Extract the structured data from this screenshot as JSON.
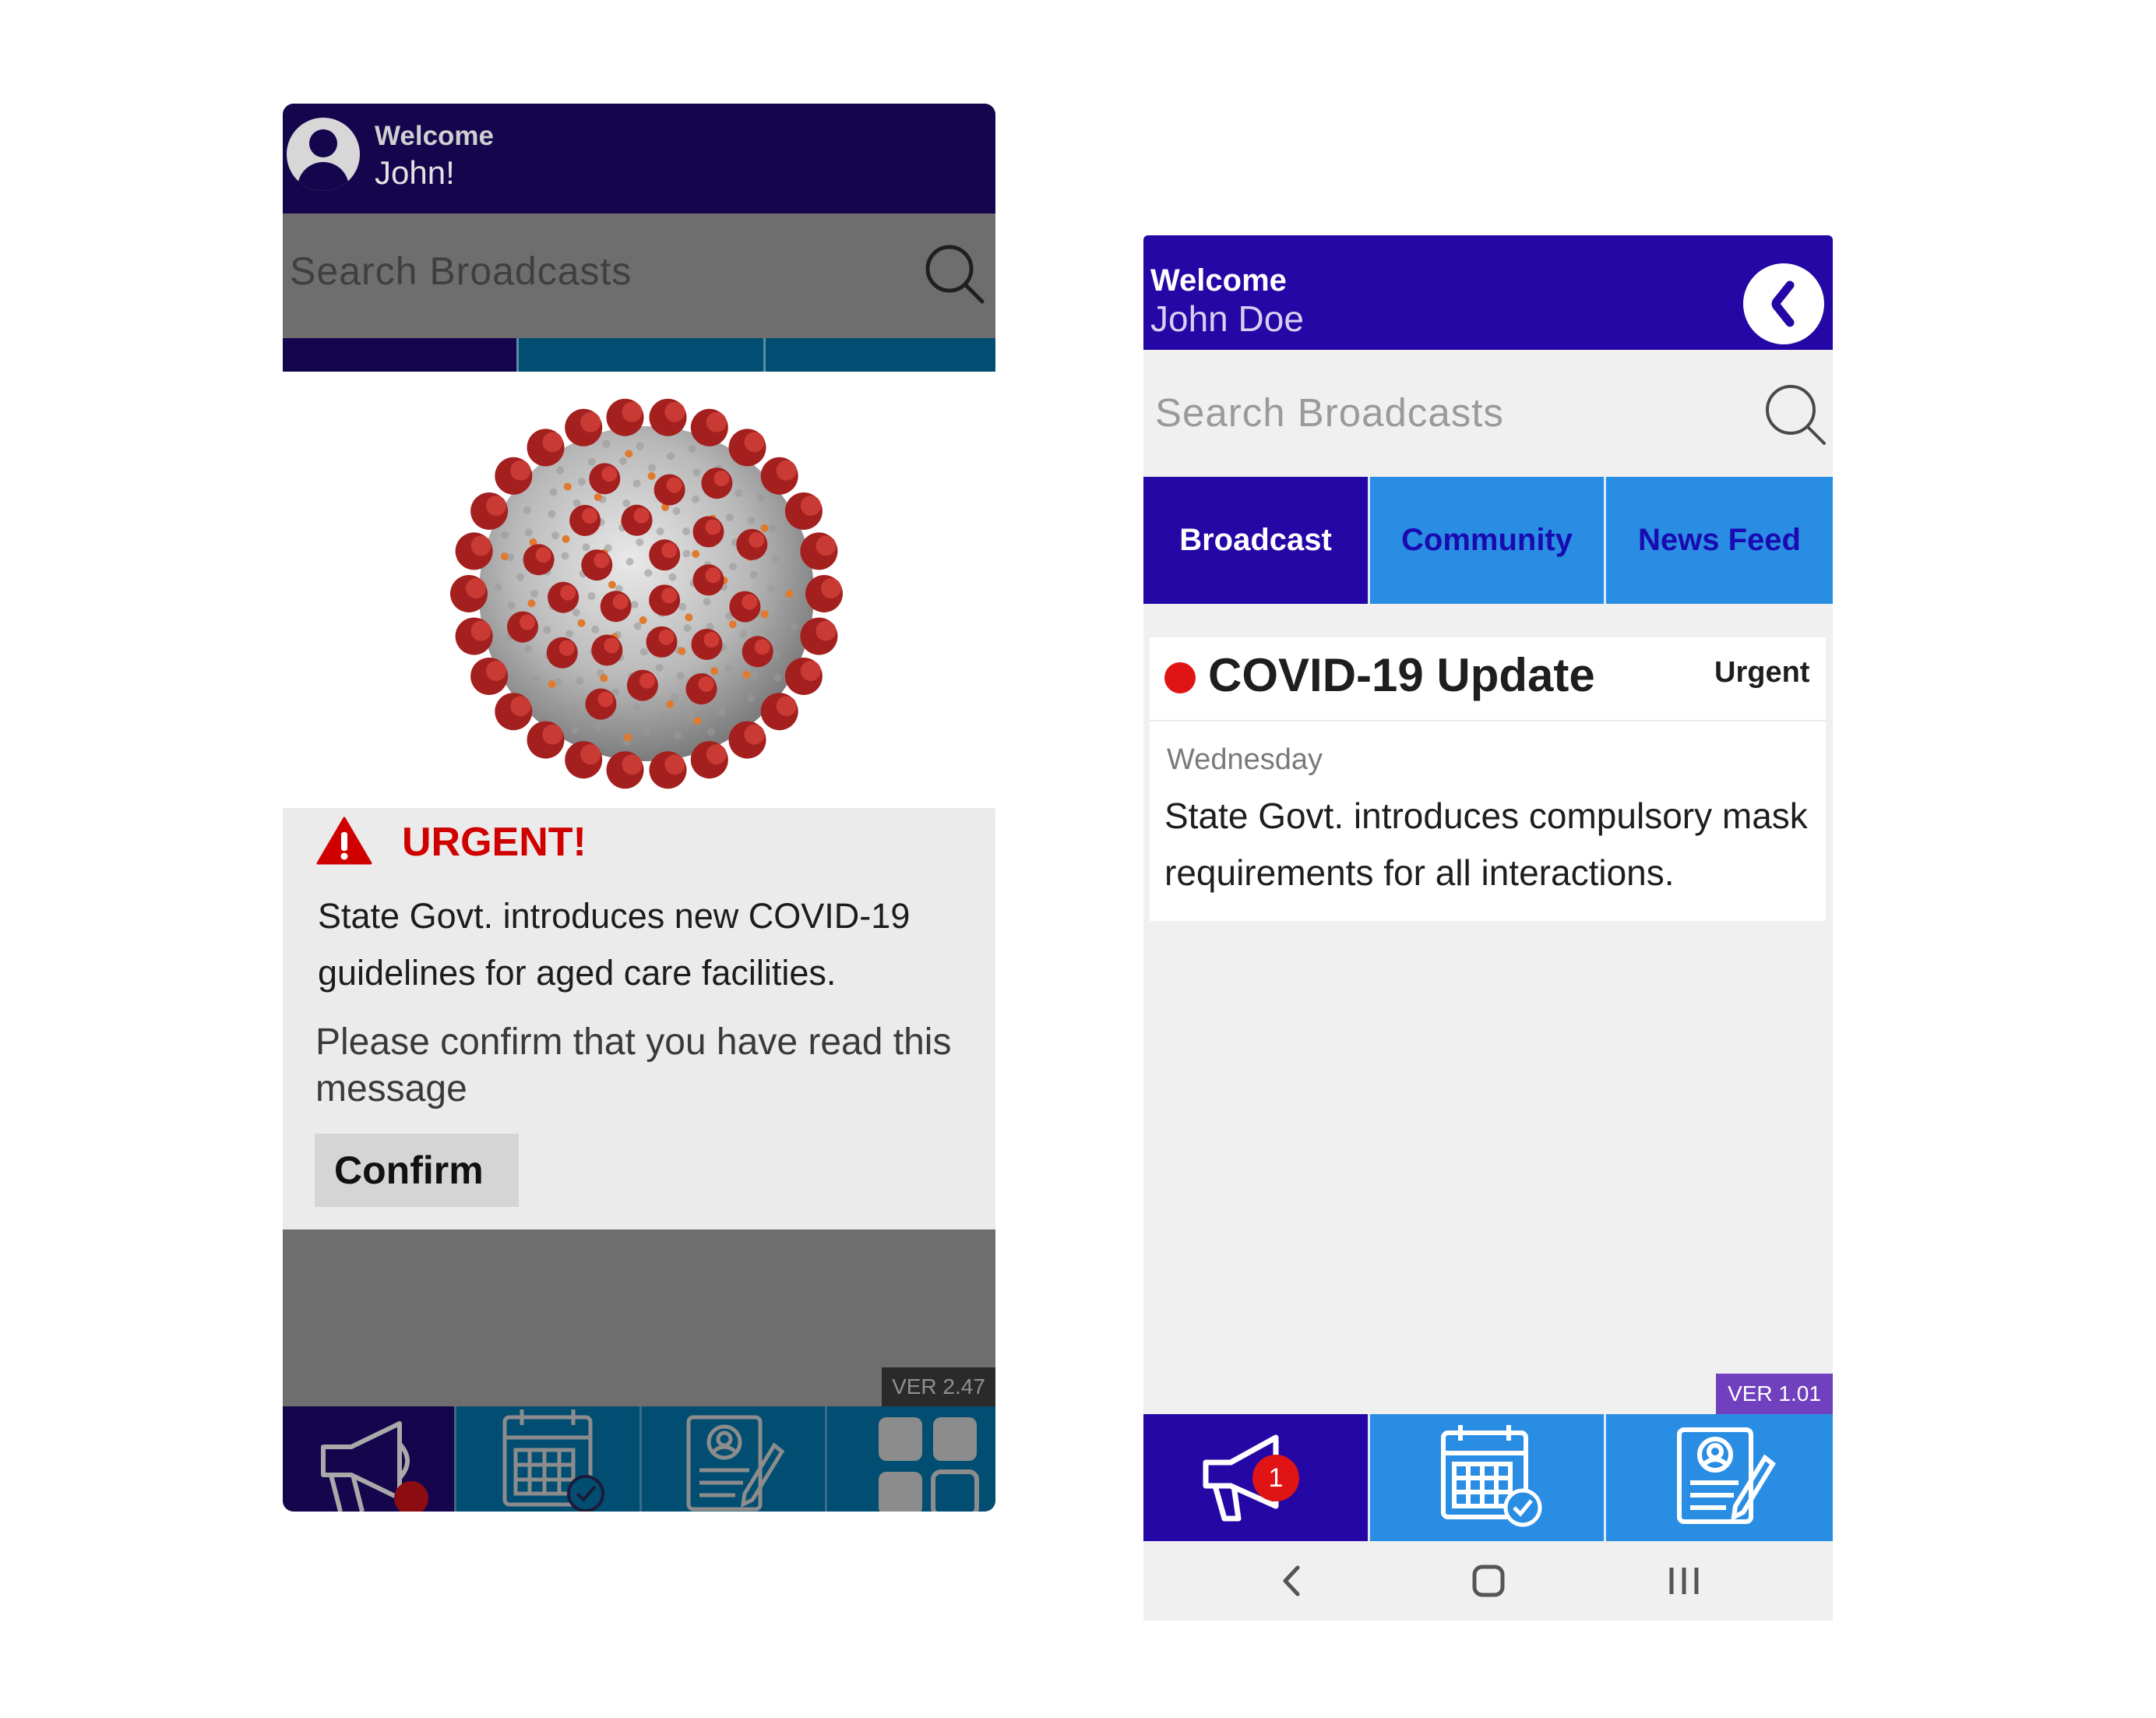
{
  "left_phone": {
    "header": {
      "welcome": "Welcome",
      "username": "John!"
    },
    "search": {
      "placeholder": "Search Broadcasts"
    },
    "message": {
      "title": "URGENT!",
      "body": "State Govt. introduces new COVID-19 guidelines for aged care facilities.",
      "confirm_prompt": "Please confirm that you have read this message",
      "confirm_label": "Confirm"
    },
    "version": "VER 2.47",
    "nav_icons": [
      "megaphone-icon",
      "calendar-check-icon",
      "profile-form-icon",
      "grid-apps-icon"
    ],
    "colors": {
      "header": "#14054d",
      "tabs": "#014e72",
      "alert": "#d00000"
    }
  },
  "right_phone": {
    "header": {
      "welcome": "Welcome",
      "username": "John Doe"
    },
    "search": {
      "placeholder": "Search Broadcasts"
    },
    "tabs": [
      {
        "label": "Broadcast",
        "active": true
      },
      {
        "label": "Community",
        "active": false
      },
      {
        "label": "News Feed",
        "active": false
      }
    ],
    "card": {
      "title": "COVID-19 Update",
      "badge": "Urgent",
      "day": "Wednesday",
      "text": "State Govt. introduces compulsory mask requirements for all interactions."
    },
    "version": "VER 1.01",
    "nav": {
      "notification_count": "1",
      "icons": [
        "megaphone-icon",
        "calendar-check-icon",
        "profile-form-icon"
      ]
    },
    "system_nav_icons": [
      "back-chevron-icon",
      "home-icon",
      "recents-icon"
    ],
    "colors": {
      "header": "#2407a4",
      "tab_active": "#2407a4",
      "tab_inactive": "#2a8de4",
      "badge": "#e01414"
    }
  }
}
